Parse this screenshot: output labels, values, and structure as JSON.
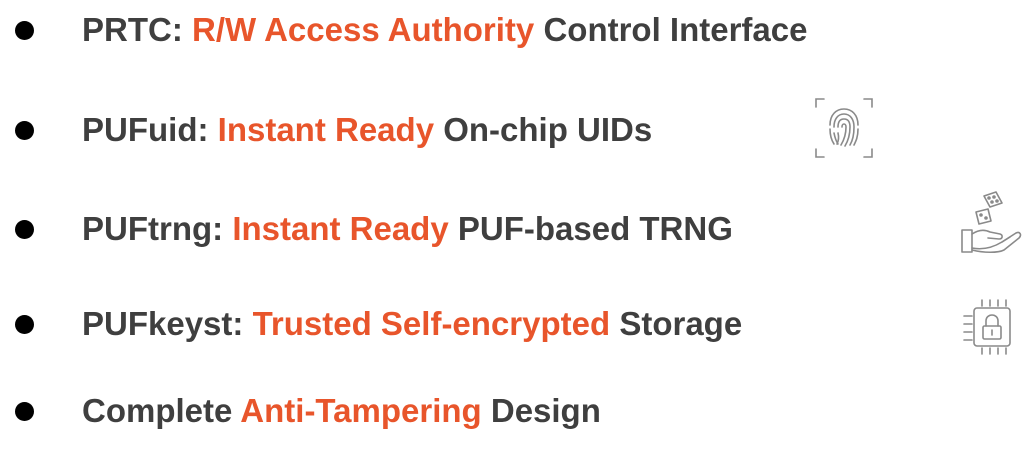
{
  "bullets": [
    {
      "prefix": "PRTC: ",
      "highlight": "R/W Access Authority",
      "suffix": " Control Interface"
    },
    {
      "prefix": "PUFuid: ",
      "highlight": "Instant Ready",
      "suffix": " On-chip UIDs",
      "icon": "fingerprint-icon"
    },
    {
      "prefix": "PUFtrng: ",
      "highlight": "Instant Ready",
      "suffix": " PUF-based TRNG",
      "icon": "dice-on-hand-icon"
    },
    {
      "prefix": "PUFkeyst: ",
      "highlight": "Trusted Self-encrypted",
      "suffix": " Storage",
      "icon": "chip-lock-icon"
    },
    {
      "prefix": "Complete ",
      "highlight": "Anti-Tampering",
      "suffix": " Design"
    }
  ],
  "colors": {
    "text": "#3f3f3f",
    "accent": "#e8552b",
    "bullet": "#000000",
    "icon_stroke": "#8a8a8a"
  }
}
